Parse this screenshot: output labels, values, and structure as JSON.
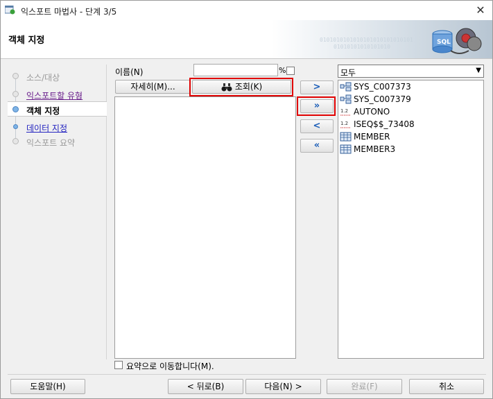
{
  "window": {
    "title": "익스포트 마법사 - 단계 3/5",
    "close_label": "✕"
  },
  "header": {
    "title": "객체 지정",
    "binary_1": "0101010101010101010101010101",
    "binary_2": "01010101010101010"
  },
  "steps": [
    {
      "label": "소스/대상",
      "state": "done"
    },
    {
      "label": "익스포트할 유형",
      "state": "visited"
    },
    {
      "label": "객체 지정",
      "state": "current"
    },
    {
      "label": "데이터 지정",
      "state": "link"
    },
    {
      "label": "익스포트 요약",
      "state": "future"
    }
  ],
  "filter": {
    "name_label": "이름(N)",
    "name_value": "",
    "percent": "%",
    "detail_button": "자세히(M)...",
    "search_button": "조회(K)"
  },
  "move_buttons": [
    ">",
    "»",
    "<",
    "«"
  ],
  "object_type": {
    "selected": "모두"
  },
  "selected_objects": [
    {
      "name": "SYS_C007373",
      "icon": "constraint-icon"
    },
    {
      "name": "SYS_C007379",
      "icon": "constraint-icon"
    },
    {
      "name": "AUTONO",
      "icon": "sequence-icon"
    },
    {
      "name": "ISEQ$$_73408",
      "icon": "sequence-icon"
    },
    {
      "name": "MEMBER",
      "icon": "table-icon"
    },
    {
      "name": "MEMBER3",
      "icon": "table-icon"
    }
  ],
  "summary_check_label": "요약으로 이동합니다(M).",
  "footer": {
    "help": "도움말(H)",
    "back": "< 뒤로(B)",
    "next": "다음(N) >",
    "finish": "완료(F)",
    "cancel": "취소"
  },
  "colors": {
    "highlight": "#e00000",
    "link": "#1f1fbf",
    "visited": "#6a1f8c",
    "arrow": "#1d5fb8"
  }
}
